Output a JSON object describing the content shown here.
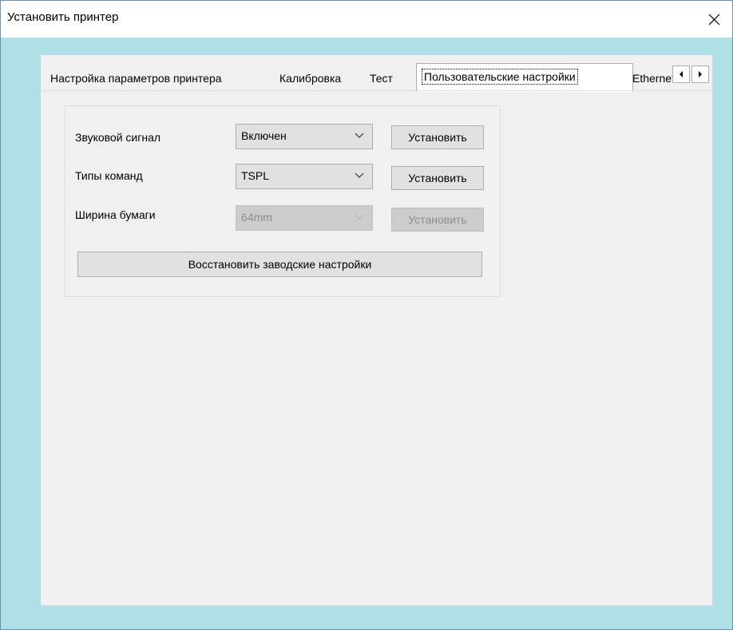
{
  "window": {
    "title": "Установить принтер"
  },
  "tabs": [
    {
      "label": "Настройка параметров принтера"
    },
    {
      "label": "Калибровка"
    },
    {
      "label": "Тест"
    },
    {
      "label": "Пользовательские настройки"
    },
    {
      "label": "Ethernet"
    }
  ],
  "settings": {
    "buzzer": {
      "label": "Звуковой сигнал",
      "value": "Включен",
      "button": "Установить"
    },
    "command_type": {
      "label": "Типы команд",
      "value": "TSPL",
      "button": "Установить"
    },
    "paper_width": {
      "label": "Ширина бумаги",
      "value": "64mm",
      "button": "Установить"
    },
    "factory_reset": "Восстановить заводские настройки"
  },
  "icons": {
    "close": "close-icon",
    "left": "arrow-left-icon",
    "right": "arrow-right-icon",
    "dropdown": "chevron-down-icon"
  },
  "colors": {
    "client_bg": "#b0dfe5",
    "panel_bg": "#f0f0f0",
    "button_bg": "#e1e1e1",
    "disabled_text": "#8c8c8c"
  }
}
